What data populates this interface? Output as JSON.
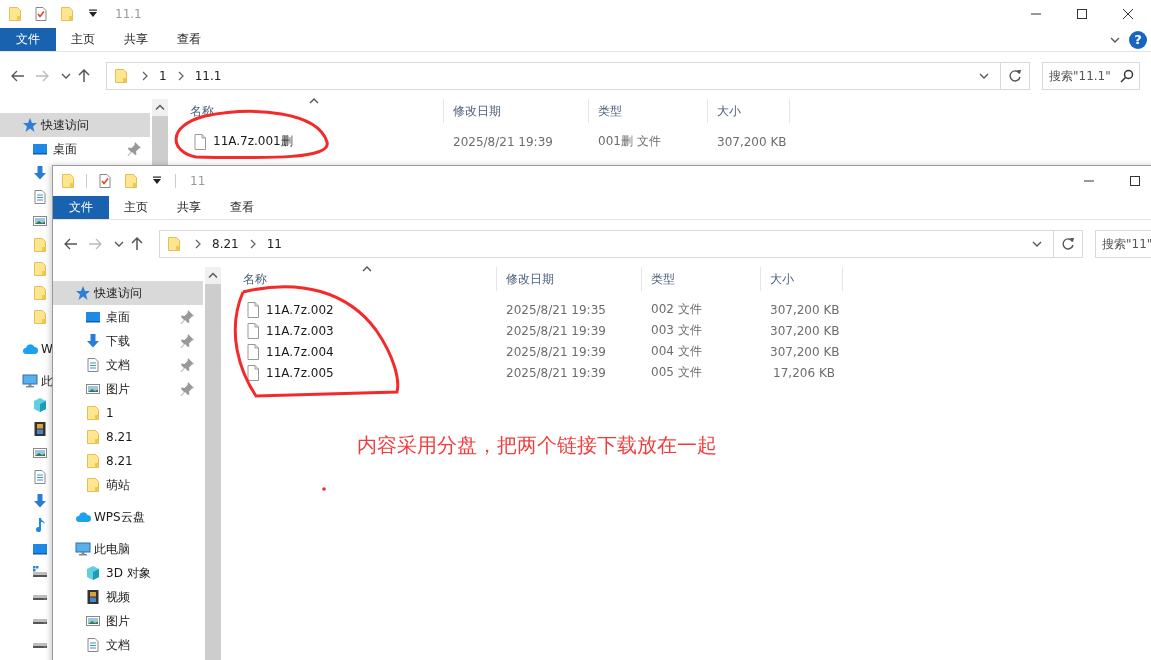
{
  "windows": [
    {
      "title": "11.1",
      "ribbon_tabs": [
        {
          "label": "文件",
          "kind": "file"
        },
        {
          "label": "主页",
          "kind": "tab"
        },
        {
          "label": "共享",
          "kind": "tab"
        },
        {
          "label": "查看",
          "kind": "tab"
        }
      ],
      "help": "?",
      "forward_disabled": true,
      "breadcrumbs": [
        "1",
        "11.1"
      ],
      "search": {
        "placeholder": "搜索\"11.1\""
      },
      "columns": [
        "名称",
        "修改日期",
        "类型",
        "大小"
      ],
      "sidebar": [
        {
          "label": "快速访问",
          "kind": "star",
          "selected": true,
          "children": [
            {
              "label": "桌面",
              "kind": "desktop",
              "pinned": true,
              "selected": false
            },
            {
              "kind": "download",
              "selected": false
            },
            {
              "kind": "document",
              "selected": false
            },
            {
              "kind": "picture",
              "selected": false
            },
            {
              "kind": "folder",
              "selected": false
            },
            {
              "kind": "folder",
              "selected": false
            },
            {
              "kind": "folder",
              "selected": false
            },
            {
              "kind": "folder",
              "selected": false
            }
          ]
        },
        {
          "label": "W",
          "kind": "cloud",
          "selected": false
        },
        {
          "label": "此",
          "kind": "computer",
          "selected": false,
          "children": [
            {
              "kind": "cube",
              "selected": false
            },
            {
              "kind": "film",
              "selected": false
            },
            {
              "kind": "picture",
              "selected": false
            },
            {
              "kind": "document",
              "selected": false
            },
            {
              "kind": "download",
              "selected": false
            },
            {
              "kind": "music",
              "selected": false
            },
            {
              "kind": "desktop",
              "selected": false
            },
            {
              "kind": "windrive",
              "selected": false
            },
            {
              "kind": "drive",
              "selected": false
            },
            {
              "kind": "drive",
              "selected": false
            },
            {
              "kind": "drive",
              "selected": false
            }
          ]
        }
      ],
      "files": [
        {
          "name": "11A.7z.001删",
          "modified": "2025/8/21 19:39",
          "type": "001删 文件",
          "size": "307,200 KB"
        }
      ]
    },
    {
      "title": "11",
      "ribbon_tabs": [
        {
          "label": "文件",
          "kind": "file"
        },
        {
          "label": "主页",
          "kind": "tab"
        },
        {
          "label": "共享",
          "kind": "tab"
        },
        {
          "label": "查看",
          "kind": "tab"
        }
      ],
      "forward_disabled": true,
      "breadcrumbs": [
        "8.21",
        "11"
      ],
      "search": {
        "placeholder": "搜索\"11\""
      },
      "columns": [
        "名称",
        "修改日期",
        "类型",
        "大小"
      ],
      "sidebar": [
        {
          "label": "快速访问",
          "kind": "star",
          "selected": true,
          "children": [
            {
              "label": "桌面",
              "kind": "desktop",
              "pinned": true,
              "selected": false
            },
            {
              "label": "下载",
              "kind": "download",
              "pinned": true,
              "selected": false
            },
            {
              "label": "文档",
              "kind": "document",
              "pinned": true,
              "selected": false
            },
            {
              "label": "图片",
              "kind": "picture",
              "pinned": true,
              "selected": false
            },
            {
              "label": "1",
              "kind": "folder",
              "pinned": false,
              "selected": false
            },
            {
              "label": "8.21",
              "kind": "folder",
              "pinned": false,
              "selected": false
            },
            {
              "label": "8.21",
              "kind": "folder",
              "pinned": false,
              "selected": false
            },
            {
              "label": "萌站",
              "kind": "folder",
              "pinned": false,
              "selected": false
            }
          ]
        },
        {
          "label": "WPS云盘",
          "kind": "cloud",
          "selected": false
        },
        {
          "label": "此电脑",
          "kind": "computer",
          "selected": false,
          "children": [
            {
              "label": "3D 对象",
              "kind": "cube",
              "selected": false
            },
            {
              "label": "视频",
              "kind": "film",
              "selected": false
            },
            {
              "label": "图片",
              "kind": "picture",
              "selected": false
            },
            {
              "label": "文档",
              "kind": "document",
              "selected": false
            }
          ]
        }
      ],
      "files": [
        {
          "name": "11A.7z.002",
          "modified": "2025/8/21 19:35",
          "type": "002 文件",
          "size": "307,200 KB"
        },
        {
          "name": "11A.7z.003",
          "modified": "2025/8/21 19:39",
          "type": "003 文件",
          "size": "307,200 KB"
        },
        {
          "name": "11A.7z.004",
          "modified": "2025/8/21 19:39",
          "type": "004 文件",
          "size": "307,200 KB"
        },
        {
          "name": "11A.7z.005",
          "modified": "2025/8/21 19:39",
          "type": "005 文件",
          "size": "17,206 KB"
        }
      ]
    }
  ],
  "annotation": {
    "note": "内容采用分盘，把两个链接下载放在一起"
  }
}
